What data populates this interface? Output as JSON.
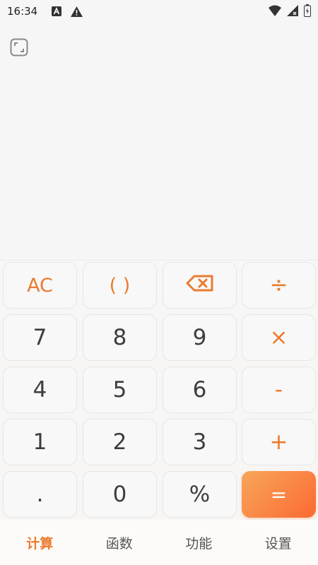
{
  "status_bar": {
    "time": "16:34",
    "icons_left": [
      "a-notification-icon",
      "warning-icon"
    ],
    "icons_right": [
      "wifi-icon",
      "signal-icon",
      "battery-icon"
    ]
  },
  "display": {
    "expand_icon": "expand-icon"
  },
  "keypad": {
    "keys": [
      {
        "label": "AC",
        "name": "clear-button",
        "style": "fn"
      },
      {
        "label": "( )",
        "name": "parentheses-button",
        "style": "fn"
      },
      {
        "label": "",
        "name": "backspace-button",
        "style": "fn",
        "icon": "backspace-icon"
      },
      {
        "label": "÷",
        "name": "divide-button",
        "style": "op"
      },
      {
        "label": "7",
        "name": "digit-7-button",
        "style": "num"
      },
      {
        "label": "8",
        "name": "digit-8-button",
        "style": "num"
      },
      {
        "label": "9",
        "name": "digit-9-button",
        "style": "num"
      },
      {
        "label": "×",
        "name": "multiply-button",
        "style": "op"
      },
      {
        "label": "4",
        "name": "digit-4-button",
        "style": "num"
      },
      {
        "label": "5",
        "name": "digit-5-button",
        "style": "num"
      },
      {
        "label": "6",
        "name": "digit-6-button",
        "style": "num"
      },
      {
        "label": "-",
        "name": "subtract-button",
        "style": "op"
      },
      {
        "label": "1",
        "name": "digit-1-button",
        "style": "num"
      },
      {
        "label": "2",
        "name": "digit-2-button",
        "style": "num"
      },
      {
        "label": "3",
        "name": "digit-3-button",
        "style": "num"
      },
      {
        "label": "+",
        "name": "add-button",
        "style": "op"
      },
      {
        "label": ".",
        "name": "decimal-button",
        "style": "num"
      },
      {
        "label": "0",
        "name": "digit-0-button",
        "style": "num"
      },
      {
        "label": "%",
        "name": "percent-button",
        "style": "num"
      },
      {
        "label": "=",
        "name": "equals-button",
        "style": "equals"
      }
    ]
  },
  "tabs": [
    {
      "label": "计算",
      "active": true
    },
    {
      "label": "函数",
      "active": false
    },
    {
      "label": "功能",
      "active": false
    },
    {
      "label": "设置",
      "active": false
    }
  ],
  "colors": {
    "accent": "#ea7b2e",
    "equals_start": "#f7a65a",
    "equals_end": "#fb6a32"
  }
}
